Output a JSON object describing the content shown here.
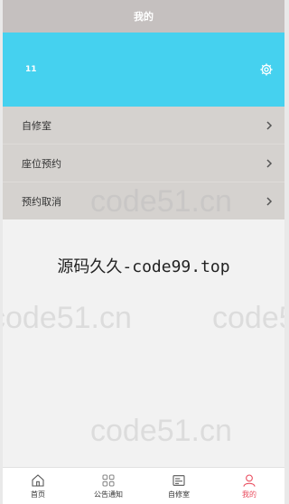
{
  "nav": {
    "title": "我的"
  },
  "profile": {
    "username": "11",
    "settings_icon": "gear-icon"
  },
  "menu": {
    "items": [
      {
        "label": "自修室",
        "icon": "chevron-right-icon"
      },
      {
        "label": "座位预约",
        "icon": "chevron-right-icon"
      },
      {
        "label": "预约取消",
        "icon": "chevron-right-icon"
      }
    ]
  },
  "content": {
    "watermark_text": "源码久久-code99.top",
    "background_watermark": "code51.cn"
  },
  "tabbar": {
    "items": [
      {
        "label": "首页",
        "icon": "home-icon"
      },
      {
        "label": "公告通知",
        "icon": "grid-icon"
      },
      {
        "label": "自修室",
        "icon": "room-icon"
      },
      {
        "label": "我的",
        "icon": "user-icon"
      }
    ],
    "active_index": 3
  },
  "colors": {
    "nav_bg": "#c5c0bf",
    "header_bg": "#45d1ef",
    "menu_bg": "#d5d2cf",
    "page_bg": "#f2f2f2",
    "accent_active": "#e94a5c"
  }
}
